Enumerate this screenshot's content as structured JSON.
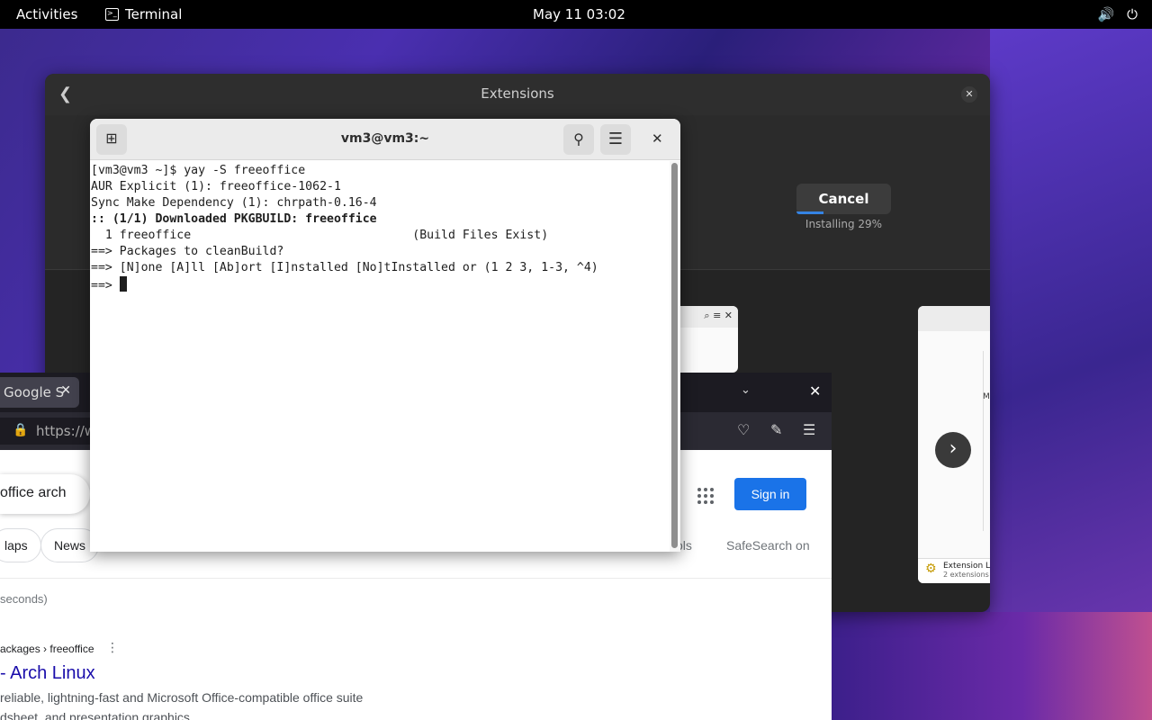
{
  "topbar": {
    "activities": "Activities",
    "app_name": "Terminal",
    "clock": "May 11  03:02",
    "volume_icon": "volume-icon",
    "power_icon": "power-icon"
  },
  "extensions": {
    "title": "Extensions",
    "cancel_label": "Cancel",
    "installing_text": "Installing 29%",
    "install_progress": 0.29,
    "card_footer_title": "Extension L",
    "card_footer_sub": "2 extensions",
    "card_text": "M"
  },
  "terminal": {
    "title": "vm3@vm3:~",
    "lines": [
      "[vm3@vm3 ~]$ yay -S freeoffice",
      "AUR Explicit (1): freeoffice-1062-1",
      "Sync Make Dependency (1): chrpath-0.16-4",
      ":: (1/1) Downloaded PKGBUILD: freeoffice",
      "  1 freeoffice                               (Build Files Exist)",
      "==> Packages to cleanBuild?",
      "==> [N]one [A]ll [Ab]ort [I]nstalled [No]tInstalled or (1 2 3, 1-3, ^4)",
      "==> "
    ]
  },
  "browser": {
    "tab_label": "Google S",
    "url": "https://w",
    "search_query": "office arch",
    "signin_label": "Sign in",
    "chips": [
      "laps",
      "News"
    ],
    "tools_label": "ols",
    "safesearch_label": "SafeSearch on",
    "stats": "seconds)",
    "result": {
      "breadcrumb": "ackages › freeoffice",
      "title": " - Arch Linux",
      "snippet1": "reliable, lightning-fast and Microsoft Office-compatible office suite",
      "snippet2": "dsheet, and presentation graphics"
    }
  }
}
